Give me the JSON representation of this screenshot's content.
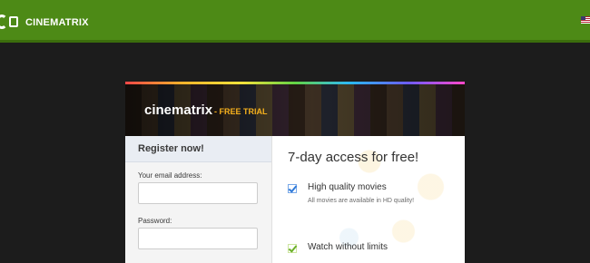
{
  "header": {
    "brand": "CINEMATRIX",
    "logo_icon": "cinematrix-logo-icon",
    "flag_icon": "us-flag-icon",
    "colors": {
      "topbar": "#4d8a16",
      "accent": "#f6b11d"
    }
  },
  "card": {
    "banner_title": "cinematrix",
    "banner_subtitle": "- FREE TRIAL",
    "register": {
      "heading": "Register now!",
      "email_label": "Your email address:",
      "email_value": "",
      "password_label": "Password:",
      "password_value": ""
    },
    "promo": {
      "title": "7-day access for free!",
      "features": [
        {
          "title": "High quality movies",
          "desc": "All movies are available in HD quality!"
        },
        {
          "title": "Watch without limits",
          "desc": ""
        }
      ]
    }
  }
}
